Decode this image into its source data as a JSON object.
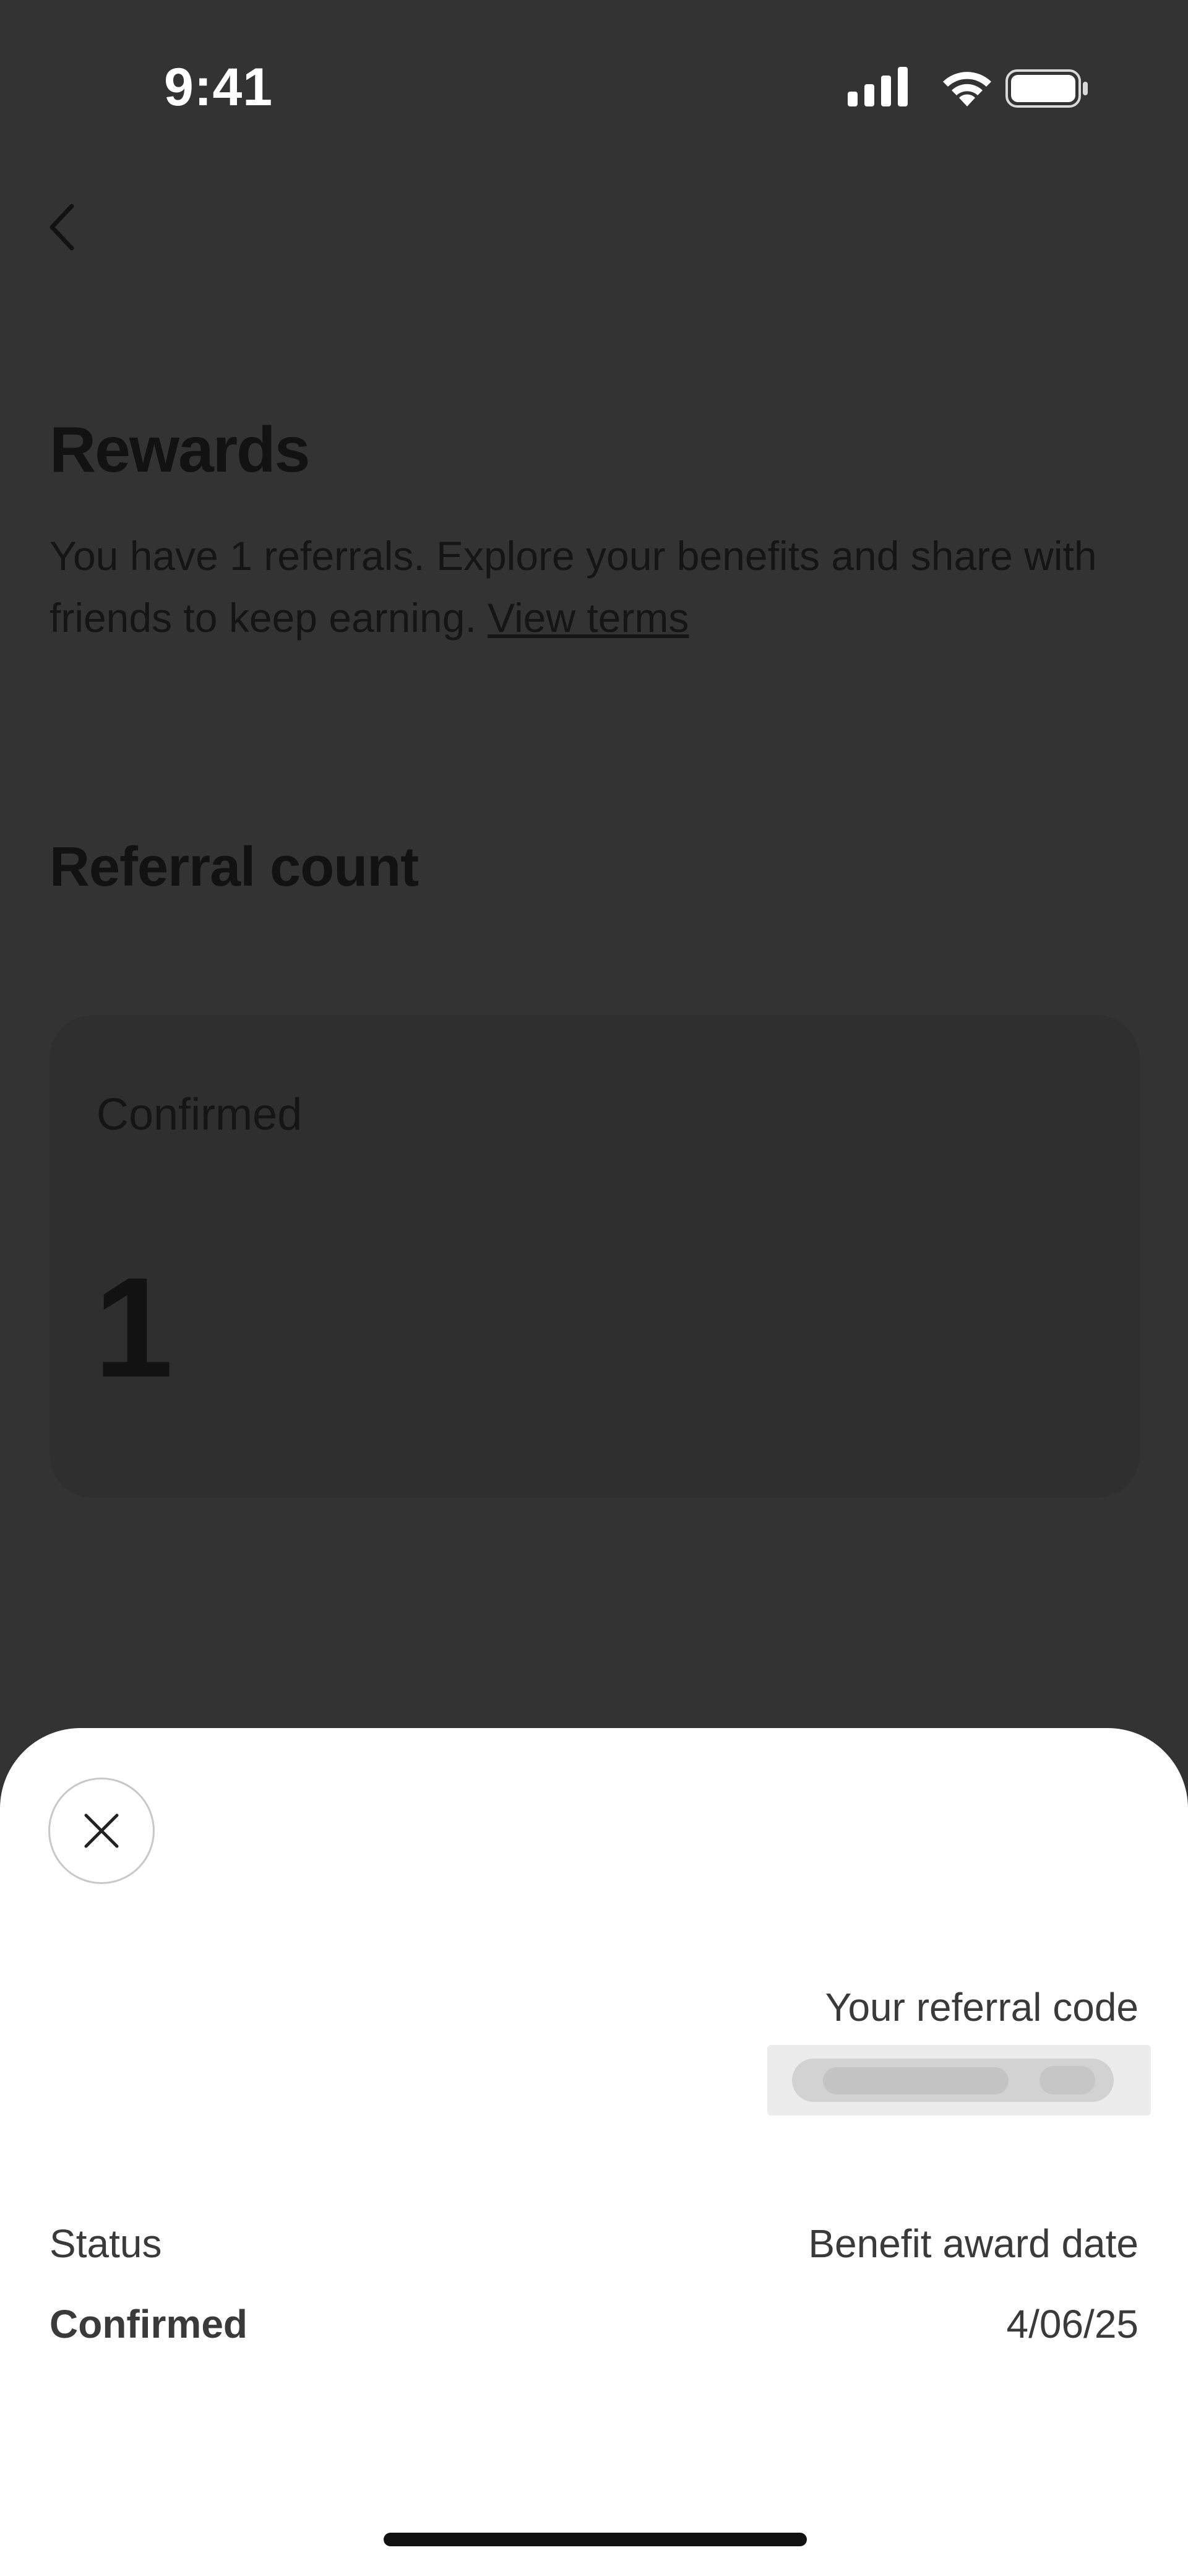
{
  "status_bar": {
    "time": "9:41",
    "icons": [
      "cellular-signal-icon",
      "wifi-icon",
      "battery-icon"
    ]
  },
  "nav": {
    "back_icon": "chevron-left-icon"
  },
  "header": {
    "title": "Rewards",
    "description": "You have 1 referrals. Explore your benefits and share with friends to keep earning.",
    "terms_link": "View terms"
  },
  "referral_section": {
    "title": "Referral count",
    "card": {
      "label": "Confirmed",
      "value": "1"
    }
  },
  "sheet": {
    "close_icon": "close-icon",
    "referral_code_label": "Your referral code",
    "status_label": "Status",
    "status_value": "Confirmed",
    "award_date_label": "Benefit award date",
    "award_date_value": "4/06/25"
  },
  "colors": {
    "overlay_background": "#333333",
    "sheet_background": "#ffffff",
    "text_dark": "#121212",
    "text_sheet": "#3a3a3a"
  }
}
